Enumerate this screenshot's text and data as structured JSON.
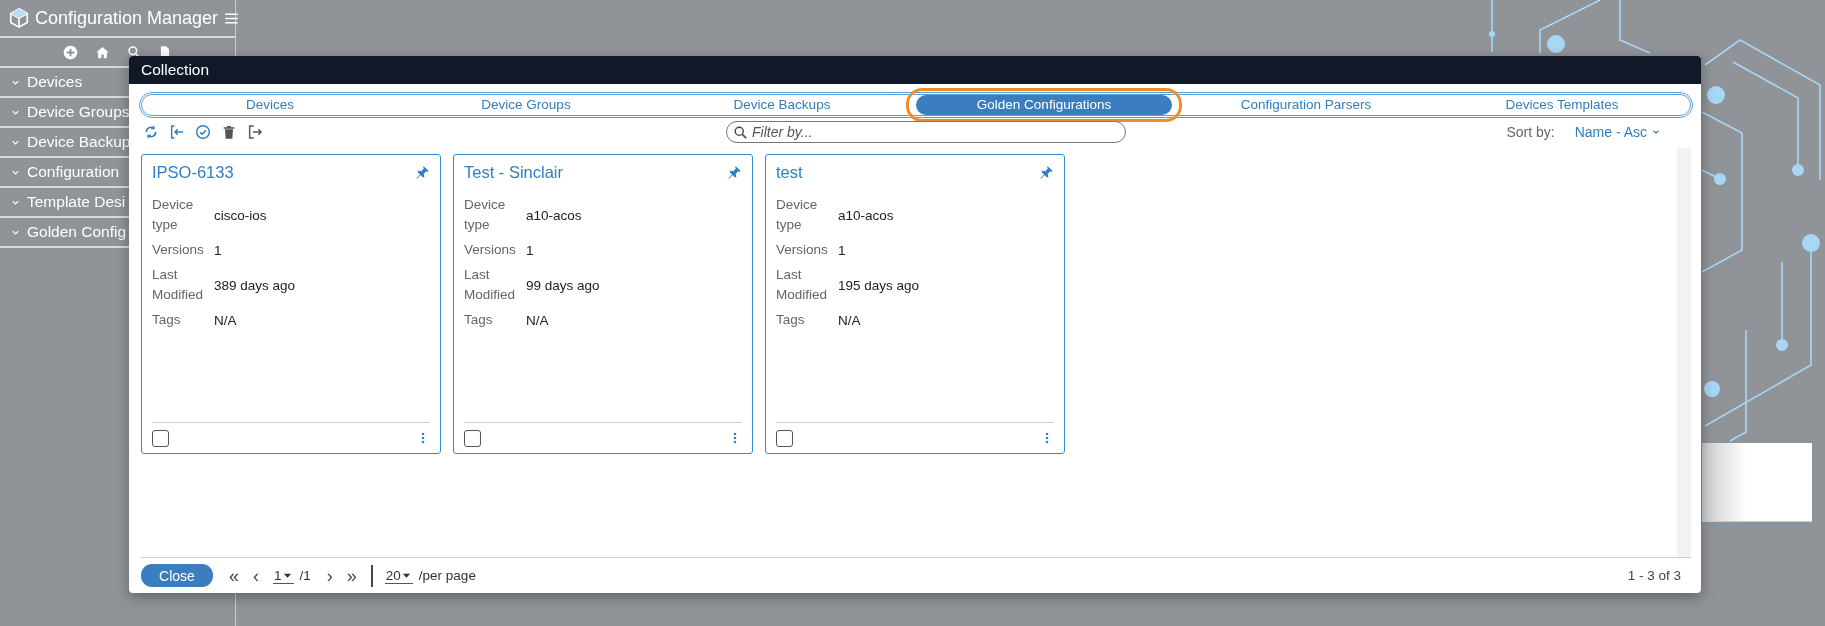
{
  "app": {
    "title": "Configuration Manager",
    "nav": [
      {
        "label": "Devices"
      },
      {
        "label": "Device Groups"
      },
      {
        "label": "Device Backup"
      },
      {
        "label": "Configuration"
      },
      {
        "label": "Template Desi"
      },
      {
        "label": "Golden Config"
      }
    ]
  },
  "dialog": {
    "title": "Collection",
    "tabs": [
      {
        "label": "Devices",
        "selected": false
      },
      {
        "label": "Device Groups",
        "selected": false
      },
      {
        "label": "Device Backups",
        "selected": false
      },
      {
        "label": "Golden Configurations",
        "selected": true
      },
      {
        "label": "Configuration Parsers",
        "selected": false
      },
      {
        "label": "Devices Templates",
        "selected": false
      }
    ],
    "filter": {
      "placeholder": "Filter by..."
    },
    "sort": {
      "label": "Sort by:",
      "value": "Name - Asc"
    },
    "cards": [
      {
        "name": "IPSO-6133",
        "checked": false,
        "fields": [
          {
            "label": "Device type",
            "value": "cisco-ios"
          },
          {
            "label": "Versions",
            "value": "1"
          },
          {
            "label": "Last Modified",
            "value": "389 days ago"
          },
          {
            "label": "Tags",
            "value": "N/A"
          }
        ]
      },
      {
        "name": "Test - Sinclair",
        "checked": false,
        "fields": [
          {
            "label": "Device type",
            "value": "a10-acos"
          },
          {
            "label": "Versions",
            "value": "1"
          },
          {
            "label": "Last Modified",
            "value": "99 days ago"
          },
          {
            "label": "Tags",
            "value": "N/A"
          }
        ]
      },
      {
        "name": "test",
        "checked": false,
        "fields": [
          {
            "label": "Device type",
            "value": "a10-acos"
          },
          {
            "label": "Versions",
            "value": "1"
          },
          {
            "label": "Last Modified",
            "value": "195 days ago"
          },
          {
            "label": "Tags",
            "value": "N/A"
          }
        ]
      }
    ],
    "footer": {
      "close": "Close",
      "first": "«",
      "prev": "‹",
      "page": "1",
      "pages": "/1",
      "next": "›",
      "last": "»",
      "per_page": "20",
      "per_page_label": "/per page",
      "range": "1 - 3 of 3"
    }
  }
}
